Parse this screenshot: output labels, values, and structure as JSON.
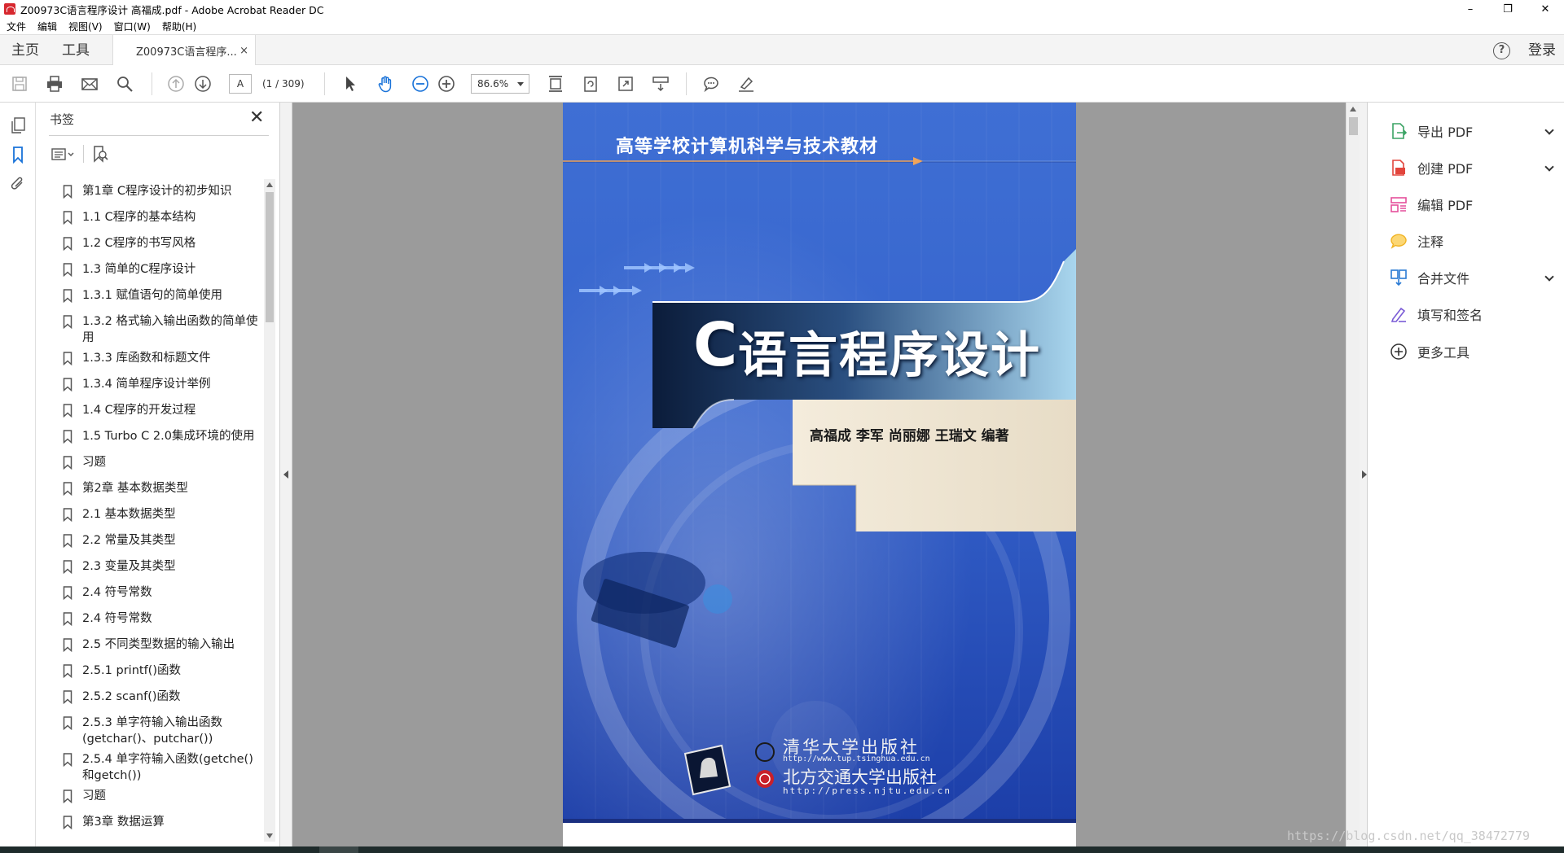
{
  "window": {
    "title": "Z00973C语言程序设计 高福成.pdf - Adobe Acrobat Reader DC",
    "controls": [
      "–",
      "❐",
      "✕"
    ]
  },
  "menu": [
    "文件",
    "编辑",
    "视图(V)",
    "窗口(W)",
    "帮助(H)"
  ],
  "tabs": {
    "home": "主页",
    "tools": "工具",
    "document": "Z00973C语言程序...",
    "close": "×",
    "help": "?",
    "login": "登录"
  },
  "toolbar": {
    "page_input": "A",
    "page_count": "(1 / 309)",
    "zoom": "86.6%"
  },
  "bookmarks": {
    "title": "书签",
    "close": "✕",
    "items": [
      "第1章 C程序设计的初步知识",
      "1.1 C程序的基本结构",
      "1.2 C程序的书写风格",
      "1.3 简单的C程序设计",
      "1.3.1 赋值语句的简单使用",
      "1.3.2 格式输入输出函数的简单使用",
      "1.3.3 库函数和标题文件",
      "1.3.4 简单程序设计举例",
      "1.4 C程序的开发过程",
      "1.5 Turbo C 2.0集成环境的使用",
      "习题",
      "第2章 基本数据类型",
      "2.1 基本数据类型",
      "2.2 常量及其类型",
      "2.3 变量及其类型",
      "2.4 符号常数",
      "2.4 符号常数",
      "2.5 不同类型数据的输入输出",
      "2.5.1 printf()函数",
      "2.5.2 scanf()函数",
      "2.5.3 单字符输入输出函数(getchar()、putchar())",
      "2.5.4 单字符输入函数(getche()和getch())",
      "习题",
      "第3章 数据运算"
    ]
  },
  "cover": {
    "series": "高等学校计算机科学与技术教材",
    "title_c": "C",
    "title": "语言程序设计",
    "authors": "高福成 李军 尚丽娜 王瑞文 编著",
    "publisher1": "清华大学出版社",
    "url1": "http://www.tup.tsinghua.edu.cn",
    "publisher2": "北方交通大学出版社",
    "url2": "http://press.njtu.edu.cn"
  },
  "tools_pane": {
    "items": [
      {
        "label": "导出 PDF",
        "color": "#3aa364"
      },
      {
        "label": "创建 PDF",
        "color": "#e2453c"
      },
      {
        "label": "编辑 PDF",
        "color": "#e44f9b"
      },
      {
        "label": "注释",
        "color": "#f0b323"
      },
      {
        "label": "合并文件",
        "color": "#2b7bd4"
      },
      {
        "label": "填写和签名",
        "color": "#7a5bd6"
      },
      {
        "label": "更多工具",
        "color": "#333333"
      }
    ]
  },
  "watermark": "https://blog.csdn.net/qq_38472779"
}
